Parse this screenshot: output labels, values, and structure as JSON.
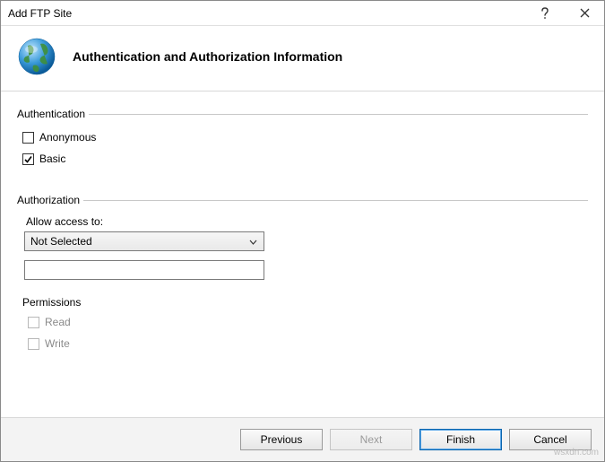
{
  "window": {
    "title": "Add FTP Site"
  },
  "header": {
    "title": "Authentication and Authorization Information"
  },
  "auth": {
    "group_label": "Authentication",
    "anonymous": {
      "label": "Anonymous",
      "checked": false
    },
    "basic": {
      "label": "Basic",
      "checked": true
    }
  },
  "authz": {
    "group_label": "Authorization",
    "allow_access_label": "Allow access to:",
    "allow_access_value": "Not Selected",
    "text_value": "",
    "permissions_label": "Permissions",
    "read": {
      "label": "Read",
      "checked": false,
      "enabled": false
    },
    "write": {
      "label": "Write",
      "checked": false,
      "enabled": false
    }
  },
  "buttons": {
    "previous": "Previous",
    "next": "Next",
    "finish": "Finish",
    "cancel": "Cancel"
  },
  "watermark": "wsxdn.com"
}
